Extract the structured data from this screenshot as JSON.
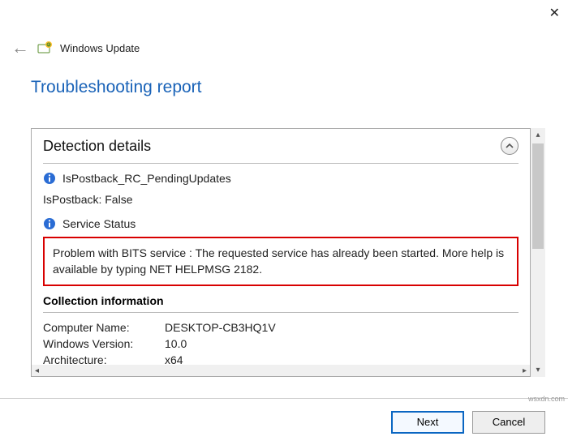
{
  "window": {
    "breadcrumb": "Windows Update"
  },
  "report": {
    "title": "Troubleshooting report"
  },
  "detection": {
    "section_title": "Detection details",
    "item1": "IsPostback_RC_PendingUpdates",
    "postback_line": "IsPostback: False",
    "item2": "Service Status",
    "problem_text": "Problem with BITS service : The requested service has already been started. More help is available by typing NET HELPMSG 2182."
  },
  "collection": {
    "section_title": "Collection information",
    "computer_name_label": "Computer Name:",
    "computer_name_value": "DESKTOP-CB3HQ1V",
    "windows_version_label": "Windows Version:",
    "windows_version_value": "10.0",
    "architecture_label": "Architecture:",
    "architecture_value": "x64"
  },
  "buttons": {
    "next": "Next",
    "cancel": "Cancel"
  },
  "watermark": "wsxdn.com"
}
